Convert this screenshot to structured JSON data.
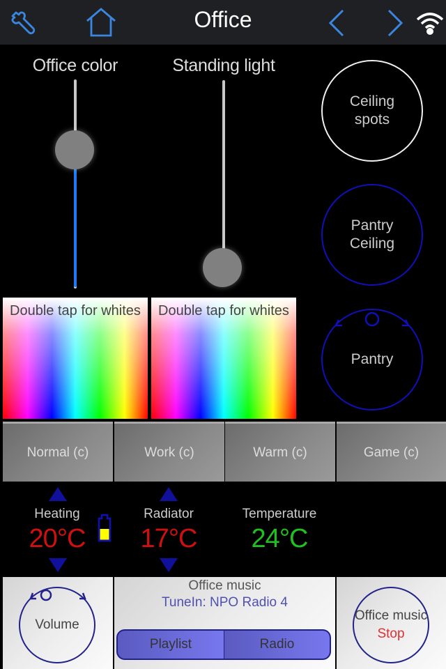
{
  "navbar": {
    "title": "Office",
    "icons": {
      "settings": "wrench-icon",
      "home": "home-icon",
      "previous": "chevron-left-icon",
      "next": "chevron-right-icon",
      "connection": "wifi-icon"
    },
    "accent_color": "#3b87e0"
  },
  "sliders": [
    {
      "label": "Office color",
      "value_percent": 70,
      "fill_color": "#1e7bf5"
    },
    {
      "label": "Standing light",
      "value_percent": 0
    }
  ],
  "round_buttons": [
    {
      "line1": "Ceiling",
      "line2": "spots",
      "state": "on",
      "ring_color": "#ffffff"
    },
    {
      "line1": "Pantry",
      "line2": "Ceiling",
      "state": "off",
      "ring_color": "#1010b8"
    },
    {
      "line1": "Pantry",
      "type": "dimmer",
      "ring_color": "#1010b8"
    }
  ],
  "color_pickers": [
    {
      "label": "Double tap for whites"
    },
    {
      "label": "Double tap for whites"
    }
  ],
  "scenes": [
    {
      "label": "Normal (c)"
    },
    {
      "label": "Work (c)"
    },
    {
      "label": "Warm (c)"
    },
    {
      "label": "Game (c)"
    }
  ],
  "climate": {
    "heating": {
      "label": "Heating",
      "value": "20°C",
      "color": "#d01010",
      "battery_level_percent": 45
    },
    "radiator": {
      "label": "Radiator",
      "value": "17°C",
      "color": "#d01010"
    },
    "temperature": {
      "label": "Temperature",
      "value": "24°C",
      "color": "#20c020"
    }
  },
  "music": {
    "volume_label": "Volume",
    "title": "Office music",
    "source": "TuneIn: NPO Radio 4",
    "source_color": "#5050b0",
    "segments": [
      {
        "label": "Playlist"
      },
      {
        "label": "Radio"
      }
    ],
    "stop_button": {
      "line1": "Office music",
      "line2": "Stop",
      "line2_color": "#e03030"
    }
  }
}
